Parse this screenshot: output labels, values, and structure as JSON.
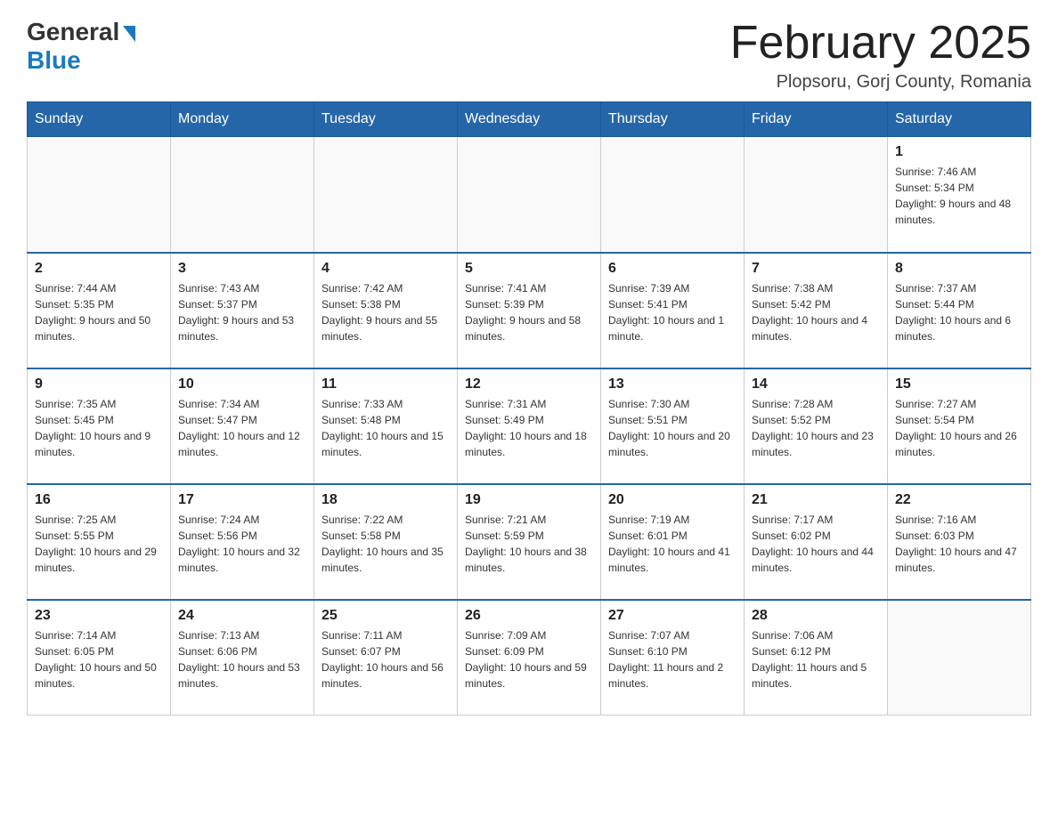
{
  "header": {
    "logo_general": "General",
    "logo_blue": "Blue",
    "month_title": "February 2025",
    "location": "Plopsoru, Gorj County, Romania"
  },
  "weekdays": [
    "Sunday",
    "Monday",
    "Tuesday",
    "Wednesday",
    "Thursday",
    "Friday",
    "Saturday"
  ],
  "weeks": [
    [
      {
        "day": "",
        "info": ""
      },
      {
        "day": "",
        "info": ""
      },
      {
        "day": "",
        "info": ""
      },
      {
        "day": "",
        "info": ""
      },
      {
        "day": "",
        "info": ""
      },
      {
        "day": "",
        "info": ""
      },
      {
        "day": "1",
        "info": "Sunrise: 7:46 AM\nSunset: 5:34 PM\nDaylight: 9 hours and 48 minutes."
      }
    ],
    [
      {
        "day": "2",
        "info": "Sunrise: 7:44 AM\nSunset: 5:35 PM\nDaylight: 9 hours and 50 minutes."
      },
      {
        "day": "3",
        "info": "Sunrise: 7:43 AM\nSunset: 5:37 PM\nDaylight: 9 hours and 53 minutes."
      },
      {
        "day": "4",
        "info": "Sunrise: 7:42 AM\nSunset: 5:38 PM\nDaylight: 9 hours and 55 minutes."
      },
      {
        "day": "5",
        "info": "Sunrise: 7:41 AM\nSunset: 5:39 PM\nDaylight: 9 hours and 58 minutes."
      },
      {
        "day": "6",
        "info": "Sunrise: 7:39 AM\nSunset: 5:41 PM\nDaylight: 10 hours and 1 minute."
      },
      {
        "day": "7",
        "info": "Sunrise: 7:38 AM\nSunset: 5:42 PM\nDaylight: 10 hours and 4 minutes."
      },
      {
        "day": "8",
        "info": "Sunrise: 7:37 AM\nSunset: 5:44 PM\nDaylight: 10 hours and 6 minutes."
      }
    ],
    [
      {
        "day": "9",
        "info": "Sunrise: 7:35 AM\nSunset: 5:45 PM\nDaylight: 10 hours and 9 minutes."
      },
      {
        "day": "10",
        "info": "Sunrise: 7:34 AM\nSunset: 5:47 PM\nDaylight: 10 hours and 12 minutes."
      },
      {
        "day": "11",
        "info": "Sunrise: 7:33 AM\nSunset: 5:48 PM\nDaylight: 10 hours and 15 minutes."
      },
      {
        "day": "12",
        "info": "Sunrise: 7:31 AM\nSunset: 5:49 PM\nDaylight: 10 hours and 18 minutes."
      },
      {
        "day": "13",
        "info": "Sunrise: 7:30 AM\nSunset: 5:51 PM\nDaylight: 10 hours and 20 minutes."
      },
      {
        "day": "14",
        "info": "Sunrise: 7:28 AM\nSunset: 5:52 PM\nDaylight: 10 hours and 23 minutes."
      },
      {
        "day": "15",
        "info": "Sunrise: 7:27 AM\nSunset: 5:54 PM\nDaylight: 10 hours and 26 minutes."
      }
    ],
    [
      {
        "day": "16",
        "info": "Sunrise: 7:25 AM\nSunset: 5:55 PM\nDaylight: 10 hours and 29 minutes."
      },
      {
        "day": "17",
        "info": "Sunrise: 7:24 AM\nSunset: 5:56 PM\nDaylight: 10 hours and 32 minutes."
      },
      {
        "day": "18",
        "info": "Sunrise: 7:22 AM\nSunset: 5:58 PM\nDaylight: 10 hours and 35 minutes."
      },
      {
        "day": "19",
        "info": "Sunrise: 7:21 AM\nSunset: 5:59 PM\nDaylight: 10 hours and 38 minutes."
      },
      {
        "day": "20",
        "info": "Sunrise: 7:19 AM\nSunset: 6:01 PM\nDaylight: 10 hours and 41 minutes."
      },
      {
        "day": "21",
        "info": "Sunrise: 7:17 AM\nSunset: 6:02 PM\nDaylight: 10 hours and 44 minutes."
      },
      {
        "day": "22",
        "info": "Sunrise: 7:16 AM\nSunset: 6:03 PM\nDaylight: 10 hours and 47 minutes."
      }
    ],
    [
      {
        "day": "23",
        "info": "Sunrise: 7:14 AM\nSunset: 6:05 PM\nDaylight: 10 hours and 50 minutes."
      },
      {
        "day": "24",
        "info": "Sunrise: 7:13 AM\nSunset: 6:06 PM\nDaylight: 10 hours and 53 minutes."
      },
      {
        "day": "25",
        "info": "Sunrise: 7:11 AM\nSunset: 6:07 PM\nDaylight: 10 hours and 56 minutes."
      },
      {
        "day": "26",
        "info": "Sunrise: 7:09 AM\nSunset: 6:09 PM\nDaylight: 10 hours and 59 minutes."
      },
      {
        "day": "27",
        "info": "Sunrise: 7:07 AM\nSunset: 6:10 PM\nDaylight: 11 hours and 2 minutes."
      },
      {
        "day": "28",
        "info": "Sunrise: 7:06 AM\nSunset: 6:12 PM\nDaylight: 11 hours and 5 minutes."
      },
      {
        "day": "",
        "info": ""
      }
    ]
  ]
}
